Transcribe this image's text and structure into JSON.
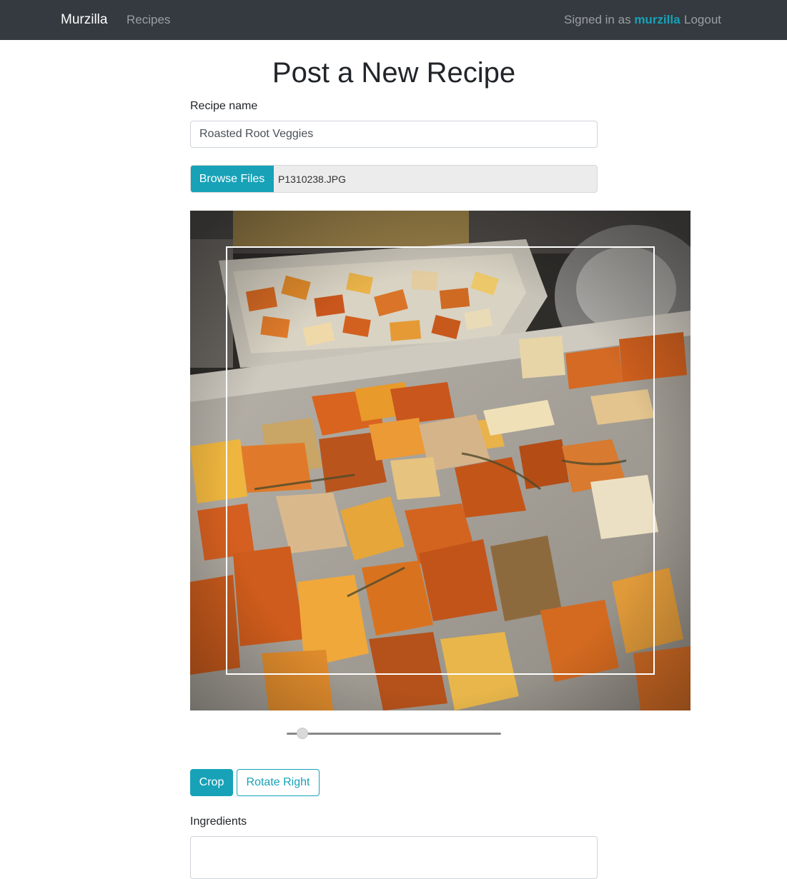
{
  "navbar": {
    "brand": "Murzilla",
    "links": [
      {
        "label": "Recipes"
      }
    ],
    "signed_in_prefix": "Signed in as",
    "username": "murzilla",
    "logout_label": "Logout",
    "background": "#343a40",
    "accent": "#17a2b8"
  },
  "page": {
    "title": "Post a New Recipe"
  },
  "form": {
    "recipe_name_label": "Recipe name",
    "recipe_name_value": "Roasted Root Veggies",
    "browse_label": "Browse Files",
    "file_name": "P1310238.JPG",
    "zoom_level": 0.05,
    "crop_label": "Crop",
    "rotate_label": "Rotate Right",
    "ingredients_label": "Ingredients",
    "ingredients_value": ""
  },
  "image": {
    "subject": "Roasted root vegetables on a sheet pan",
    "crop_box_color": "#ffffff"
  }
}
